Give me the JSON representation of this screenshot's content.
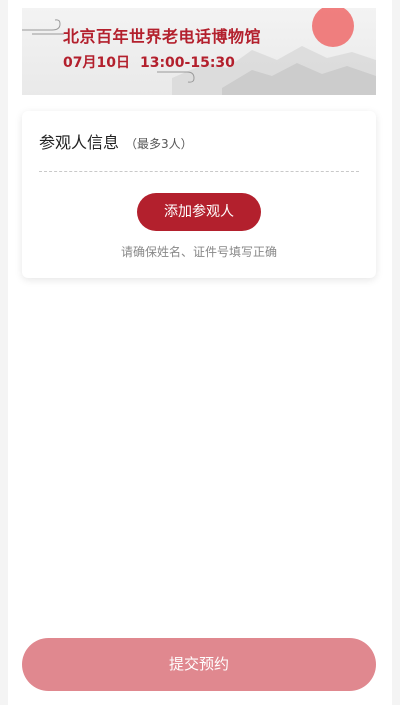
{
  "banner": {
    "venue_title": "北京百年世界老电话博物馆",
    "date": "07月10日",
    "time_range": "13:00-15:30"
  },
  "visitor_card": {
    "title": "参观人信息",
    "limit_hint": "（最多3人）",
    "add_button_label": "添加参观人",
    "note": "请确保姓名、证件号填写正确"
  },
  "footer": {
    "submit_label": "提交预约"
  },
  "colors": {
    "brand_red": "#b3202d",
    "submit_disabled": "#e0888f",
    "sun": "#ef6a6a"
  }
}
